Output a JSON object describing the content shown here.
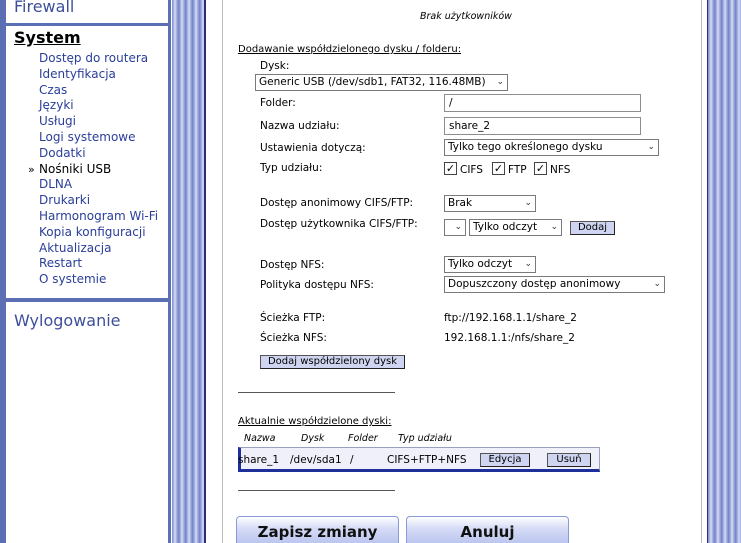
{
  "sidebar": {
    "firewall": "Firewall",
    "system": "System",
    "items": [
      {
        "label": "Dostęp do routera"
      },
      {
        "label": "Identyfikacja"
      },
      {
        "label": "Czas"
      },
      {
        "label": "Języki"
      },
      {
        "label": "Usługi"
      },
      {
        "label": "Logi systemowe"
      },
      {
        "label": "Dodatki"
      },
      {
        "label": "Nośniki USB",
        "active": true
      },
      {
        "label": "DLNA"
      },
      {
        "label": "Drukarki"
      },
      {
        "label": "Harmonogram Wi-Fi"
      },
      {
        "label": "Kopia konfiguracji"
      },
      {
        "label": "Aktualizacja"
      },
      {
        "label": "Restart"
      },
      {
        "label": "O systemie"
      }
    ],
    "active_marker": "»",
    "logout": "Wylogowanie"
  },
  "users": {
    "empty_text": "Brak użytkowników"
  },
  "add_share": {
    "title": "Dodawanie współdzielonego dysku / folderu:",
    "disk_label": "Dysk:",
    "disk_value": "Generic USB (/dev/sdb1, FAT32, 116.48MB)",
    "folder_label": "Folder:",
    "folder_value": "/",
    "share_name_label": "Nazwa udziału:",
    "share_name_value": "share_2",
    "settings_label": "Ustawienia dotyczą:",
    "settings_value": "Tylko tego określonego dysku",
    "type_label": "Typ udziału:",
    "type_cifs": "CIFS",
    "type_ftp": "FTP",
    "type_nfs": "NFS",
    "check_mark": "✓",
    "anon_access_label": "Dostęp anonimowy CIFS/FTP:",
    "anon_access_value": "Brak",
    "user_access_label": "Dostęp użytkownika CIFS/FTP:",
    "user_access_user_value": "",
    "user_access_mode_value": "Tylko odczyt",
    "add_button": "Dodaj",
    "nfs_access_label": "Dostęp NFS:",
    "nfs_access_value": "Tylko odczyt",
    "nfs_policy_label": "Polityka dostępu NFS:",
    "nfs_policy_value": "Dopuszczony dostęp anonimowy",
    "ftp_path_label": "Ścieżka FTP:",
    "ftp_path_value": "ftp://192.168.1.1/share_2",
    "nfs_path_label": "Ścieżka NFS:",
    "nfs_path_value": "192.168.1.1:/nfs/share_2",
    "submit_button": "Dodaj współdzielony dysk"
  },
  "current_shares": {
    "title": "Aktualnie współdzielone dyski:",
    "columns": [
      "Nazwa",
      "Dysk",
      "Folder",
      "Typ udziału"
    ],
    "rows": [
      {
        "name": "share_1",
        "disk": "/dev/sda1",
        "folder": "/",
        "type": "CIFS+FTP+NFS",
        "edit": "Edycja",
        "delete": "Usuń"
      }
    ]
  },
  "footer": {
    "save": "Zapisz zmiany",
    "cancel": "Anuluj"
  },
  "dropdown_arrow": "⌄",
  "colors": {
    "sidebar_bg": "#5c6fb4",
    "link": "#2a3e9a",
    "button_bg": "#cfd5f0",
    "accent_border": "#1e2f9a"
  }
}
